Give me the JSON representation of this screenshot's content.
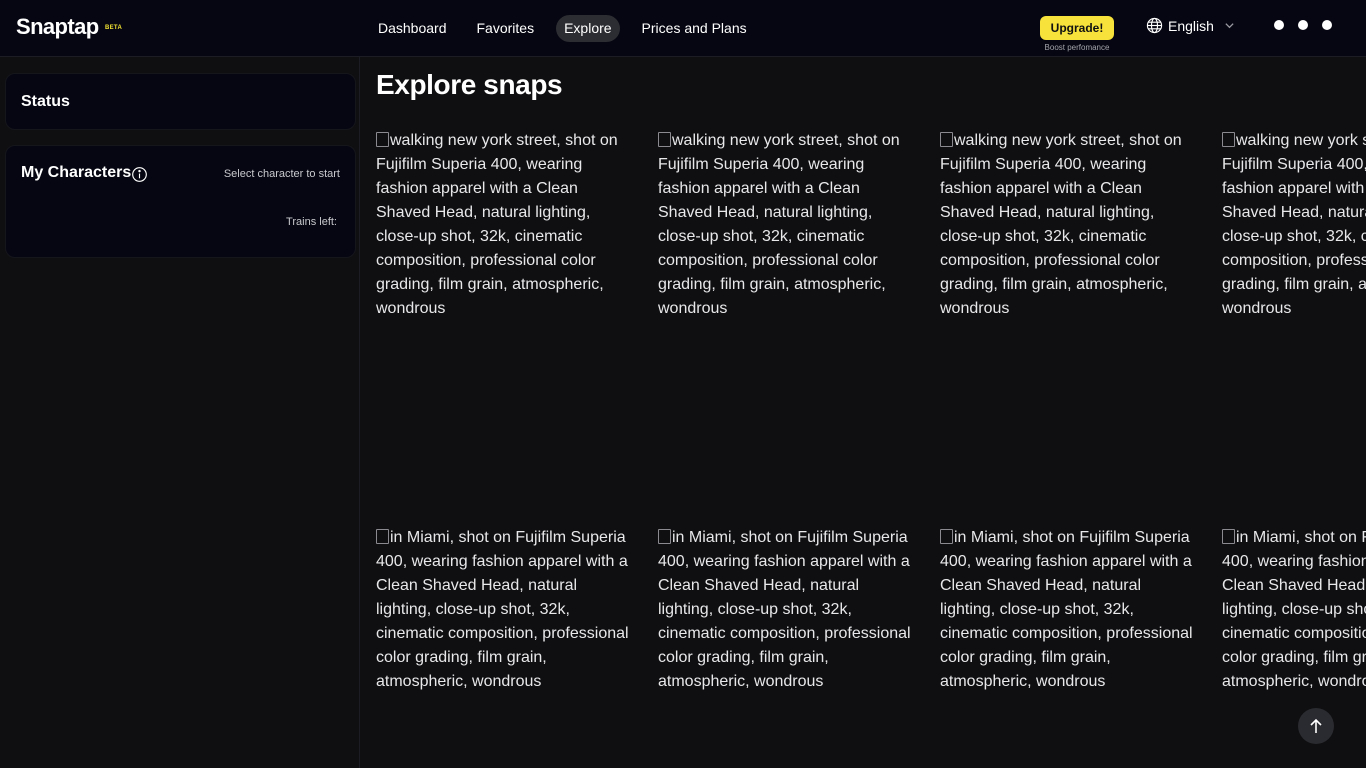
{
  "header": {
    "logo": "Snaptap",
    "badge": "BETA",
    "nav": [
      {
        "label": "Dashboard",
        "active": false
      },
      {
        "label": "Favorites",
        "active": false
      },
      {
        "label": "Explore",
        "active": true
      },
      {
        "label": "Prices and Plans",
        "active": false
      }
    ],
    "upgrade_label": "Upgrade!",
    "upgrade_sub": "Boost perfomance",
    "language": "English",
    "accent": "#f6e23a"
  },
  "sidebar": {
    "status_title": "Status",
    "characters_title": "My Characters",
    "select_hint": "Select character to start",
    "trains_left": "Trains left:"
  },
  "main": {
    "title": "Explore snaps",
    "rows": [
      {
        "alt": "walking new york street, shot on Fujifilm Superia 400, wearing fashion apparel with a Clean Shaved Head, natural lighting, close-up shot, 32k, cinematic composition, professional color grading, film grain, atmospheric, wondrous",
        "count": 4
      },
      {
        "alt": "in Miami, shot on Fujifilm Superia 400, wearing fashion apparel with a Clean Shaved Head, natural lighting, close-up shot, 32k, cinematic composition, professional color grading, film grain, atmospheric, wondrous",
        "count": 4
      }
    ]
  }
}
